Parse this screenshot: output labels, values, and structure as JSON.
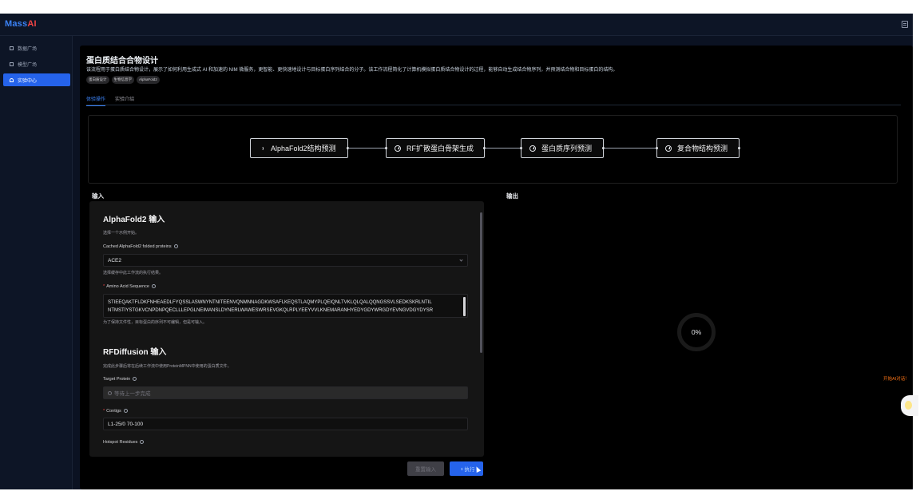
{
  "app": {
    "logo_text": "Mass",
    "logo_accent": "AI"
  },
  "sidebar": {
    "items": [
      {
        "label": "数据广场",
        "icon": "database-icon"
      },
      {
        "label": "模型广场",
        "icon": "grid-icon"
      },
      {
        "label": "实验中心",
        "icon": "home-icon",
        "active": true
      }
    ]
  },
  "page": {
    "title": "蛋白质结合合物设计",
    "description": "该流程用于蛋白质结合物设计，展示了如何利用生成式 AI 和加速的 NIM 微服务，更智能、更快速地设计与目标蛋白序列结合的分子。该工作流程简化了计算机模拟蛋白质结合物设计的过程，能够自动生成结合物序列，并预测结合物和目标蛋白的结构。",
    "tags": [
      "蛋白质设计",
      "生物信息学",
      "AlphaFold2"
    ],
    "tabs": [
      {
        "label": "体验操作",
        "active": true
      },
      {
        "label": "实验介绍",
        "active": false
      }
    ]
  },
  "workflow": {
    "nodes": [
      {
        "label": "AlphaFold2结构预测",
        "state": "running"
      },
      {
        "label": "RF扩散蛋白骨架生成",
        "state": "pending"
      },
      {
        "label": "蛋白质序列预测",
        "state": "pending"
      },
      {
        "label": "复合物结构预测",
        "state": "pending"
      }
    ]
  },
  "input": {
    "section_label": "输入",
    "alphafold": {
      "heading": "AlphaFold2 输入",
      "hint": "选择一个示例开始。",
      "cached_label": "Cached AlphaFold2 folded proteins",
      "cached_value": "ACE2",
      "cached_help": "选择缓存中此工作流的执行结果。",
      "seq_label": "Amino Acid Sequence",
      "seq_line1": "STIEEQAKTFLDKFNHEAEDLFYQSSLASWNYNTNITEENVQNMNNAGDKWSAFLKEQSTLAQMYPLQEIQNLTVKLQLQALQQNGSSVLSEDKSKRLNTIL",
      "seq_line2": "NTMSTIYSTGKVCNPDNPQECLLLEPGLNEIMANSLDYNERLWAWESWRSEVGKQLRPLYEEYVVLKNEMARANHYEDYGDYWRGDYEVNGVDGYDYSR",
      "seq_help": "为了保持文件性，目标蛋白的序列不可编辑，但是可输入。"
    },
    "rfdiffusion": {
      "heading": "RFDiffusion 输入",
      "hint": "完成此步骤后将在后续工作流中使用ProteinMPNN中使用的蛋白质文件。",
      "target_label": "Target Protein",
      "target_placeholder": "等待上一步完成",
      "contigs_label": "Contigs",
      "contigs_value": "L1-25/0 70-100",
      "hotspot_label": "Hotspot Residues"
    },
    "reset_label": "重置输入",
    "run_label": "执行"
  },
  "output": {
    "section_label": "输出",
    "progress_text": "0%",
    "progress": 0
  },
  "assistant": {
    "label": "开始AI对话！"
  }
}
